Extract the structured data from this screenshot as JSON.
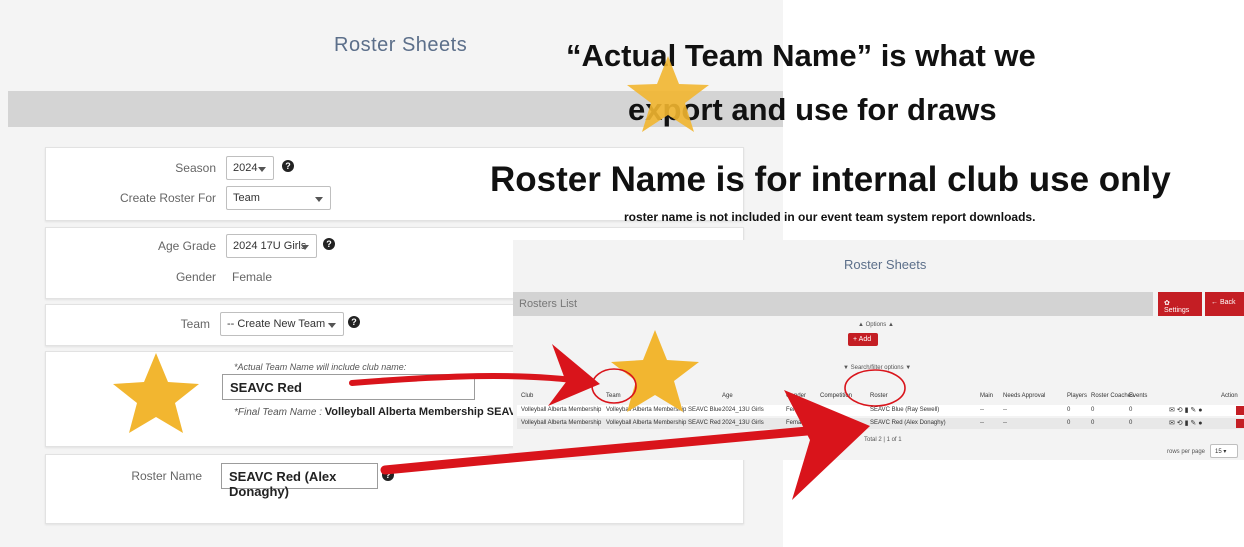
{
  "left_form": {
    "title": "Roster Sheets",
    "season_label": "Season",
    "season_value": "2024",
    "create_for_label": "Create Roster For",
    "create_for_value": "Team",
    "age_grade_label": "Age Grade",
    "age_grade_value": "2024 17U Girls",
    "gender_label": "Gender",
    "gender_value": "Female",
    "team_label": "Team",
    "team_value": "-- Create New Team --",
    "actual_team_hint": "*Actual Team Name will include club name:",
    "actual_team_value": "SEAVC Red",
    "final_team_label": "*Final Team Name :",
    "final_team_value": "Volleyball Alberta Membership SEAVC Red",
    "roster_name_label": "Roster Name",
    "roster_name_value": "SEAVC Red (Alex Donaghy)",
    "help_glyph": "?"
  },
  "annotations": {
    "headline_1": "“Actual Team Name” is what we",
    "headline_2": "export and use for draws",
    "headline_3": "Roster Name is for internal club use only",
    "subnote": "roster name is not included in our event team system report downloads."
  },
  "rosters_list": {
    "page_title": "Roster Sheets",
    "list_title": "Rosters List",
    "settings_label": "Settings",
    "back_label": "Back",
    "options_label": "Options",
    "add_label": "+ Add",
    "search_label": "Search/filter options",
    "columns": [
      "Club",
      "Team",
      "Age",
      "Gender",
      "Competition",
      "Roster",
      "Main",
      "Needs Approval",
      "Players",
      "Roster Coaches",
      "Events",
      "Action"
    ],
    "rows": [
      {
        "club": "Volleyball Alberta Membership",
        "team": "Volleyball Alberta Membership SEAVC Blue",
        "age": "2024_13U Girls",
        "gender": "Female",
        "competition": "--",
        "roster": "SEAVC Blue (Ray Sewell)",
        "main": "--",
        "needs_approval": "--",
        "players": "0",
        "coaches": "0",
        "events": "0"
      },
      {
        "club": "Volleyball Alberta Membership",
        "team": "Volleyball Alberta Membership SEAVC Red",
        "age": "2024_13U Girls",
        "gender": "Female",
        "competition": "--",
        "roster": "SEAVC Red (Alex Donaghy)",
        "main": "--",
        "needs_approval": "--",
        "players": "0",
        "coaches": "0",
        "events": "0"
      }
    ],
    "total_text": "Total 2",
    "page_text": "1 of 1",
    "rows_per_page_label": "rows per page",
    "rows_per_page_value": "15"
  },
  "colors": {
    "accent_red": "#c41e24",
    "star": "#f2b630",
    "arrow": "#d9141b",
    "title_blue": "#5c6f8a"
  }
}
